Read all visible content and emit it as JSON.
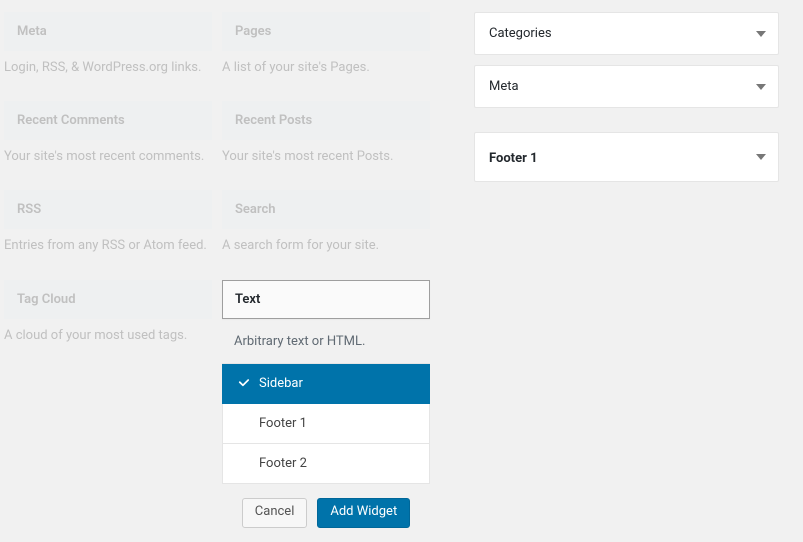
{
  "available_widgets_left": [
    {
      "title": "Meta",
      "desc": "Login, RSS, & WordPress.org links."
    },
    {
      "title": "Recent Comments",
      "desc": "Your site's most recent comments."
    },
    {
      "title": "RSS",
      "desc": "Entries from any RSS or Atom feed."
    },
    {
      "title": "Tag Cloud",
      "desc": "A cloud of your most used tags."
    }
  ],
  "available_widgets_right": [
    {
      "title": "Pages",
      "desc": "A list of your site's Pages."
    },
    {
      "title": "Recent Posts",
      "desc": "Your site's most recent Posts."
    },
    {
      "title": "Search",
      "desc": "A search form for your site."
    }
  ],
  "open_widget": {
    "title": "Text",
    "desc": "Arbitrary text or HTML.",
    "areas": [
      {
        "label": "Sidebar",
        "selected": true
      },
      {
        "label": "Footer 1",
        "selected": false
      },
      {
        "label": "Footer 2",
        "selected": false
      }
    ],
    "cancel_label": "Cancel",
    "add_label": "Add Widget"
  },
  "sidebar_areas": {
    "inner_items": [
      {
        "label": "Categories"
      },
      {
        "label": "Meta"
      }
    ],
    "areas_collapsed": [
      {
        "label": "Footer 1"
      }
    ]
  }
}
